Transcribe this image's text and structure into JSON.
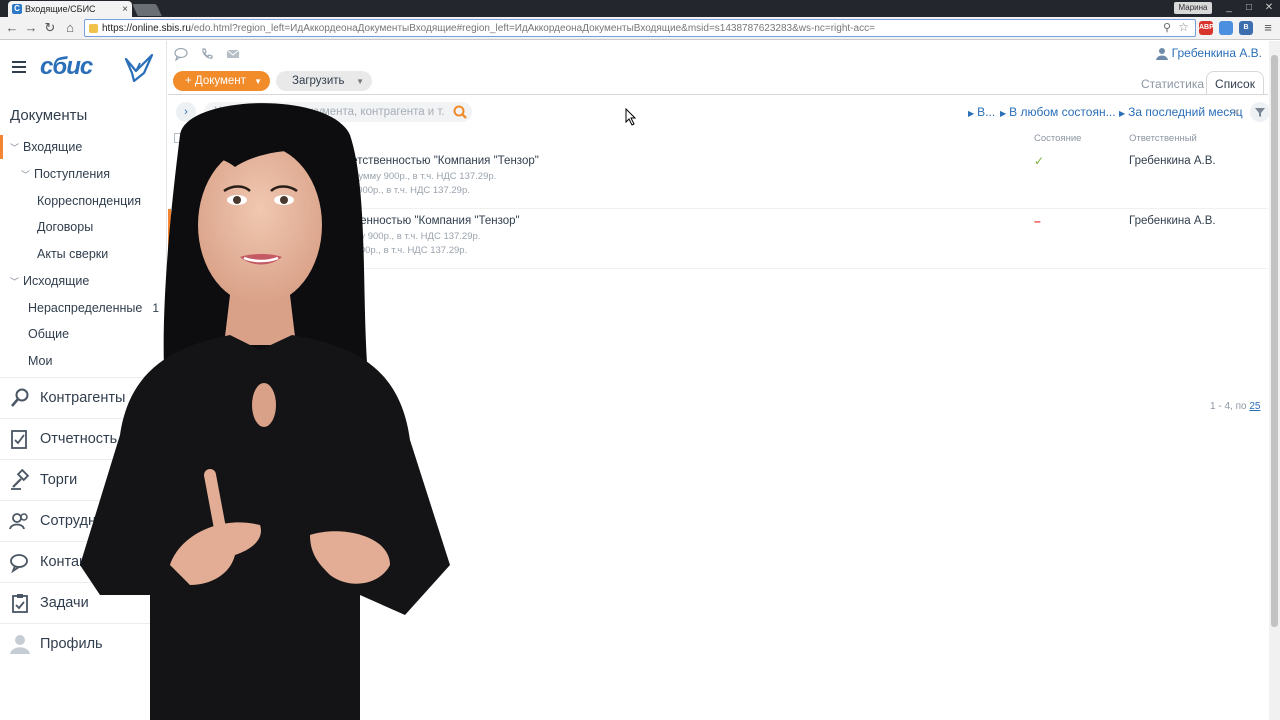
{
  "browser": {
    "tab_title": "Входящие/СБИС",
    "tab_favicon": "С",
    "close_tab": "×",
    "profile_name": "Марина",
    "url_host": "https://online.sbis.ru",
    "url_path": "/edo.html?region_left=ИдАккордеонаДокументыВходящие#region_left=ИдАккордеонаДокументыВходящие&msid=s1438787623283&ws-nc=right-acc=",
    "ext_labels": [
      "ABP",
      "",
      "B"
    ]
  },
  "sidebar": {
    "logo_text": "сбис",
    "section_title": "Документы",
    "tree": [
      {
        "label": "Входящие",
        "chev": "﹀",
        "active": true
      },
      {
        "label": "Поступления",
        "chev": "﹀"
      },
      {
        "label": "Корреспонденция"
      },
      {
        "label": "Договоры"
      },
      {
        "label": "Акты сверки"
      },
      {
        "label": "Исходящие",
        "chev": "﹀"
      },
      {
        "label": "Нераспределенные",
        "count": "1"
      },
      {
        "label": "Общие"
      },
      {
        "label": "Мои"
      }
    ],
    "sections": [
      {
        "label": "Контрагенты",
        "icon": "search-icon"
      },
      {
        "label": "Отчетность",
        "icon": "report-icon"
      },
      {
        "label": "Торги",
        "icon": "auction-icon"
      },
      {
        "label": "Сотрудники",
        "icon": "people-icon"
      },
      {
        "label": "Контакты",
        "icon": "chat-icon"
      },
      {
        "label": "Задачи",
        "icon": "tasks-icon"
      },
      {
        "label": "Профиль",
        "icon": "profile-icon"
      }
    ]
  },
  "header": {
    "user_name": "Гребенкина А.В.",
    "btn_document": "+ Документ",
    "btn_upload": "Загрузить",
    "tab_stats": "Статистика",
    "tab_list": "Список"
  },
  "filters": {
    "search_placeholder": "Укажите номер документа, контрагента и т.д.",
    "chip_type": "В...",
    "chip_state": "В любом состоян...",
    "chip_period": "За последний месяц",
    "chip_close": "×"
  },
  "list": {
    "col_state": "Состояние",
    "col_responsible": "Ответственный",
    "rows": [
      {
        "title": "05.0                                   й ответственностью \"Компания \"Тензор\"",
        "line1": "1                                          5.08.15 на сумму 900р., в т.ч. НДС 137.29р.",
        "line2": "                                          15 на сумму 900р., в т.ч. НДС 137.29р.",
        "state": "✓",
        "state_color": "#7cb342",
        "responsible": "Гребенкина А.В."
      },
      {
        "title": "                                       ответственностью \"Компания \"Тензор\"",
        "line1": "                                           8.15 на сумму 900р., в т.ч. НДС 137.29р.",
        "line2": "                                           5 на сумму 900р., в т.ч. НДС 137.29р.",
        "state": "–",
        "state_color": "#e53935",
        "responsible": "Гребенкина А.В."
      }
    ],
    "pager_text": "1 - 4, по ",
    "pager_link": "25"
  },
  "colors": {
    "accent": "#f38533",
    "brand_blue": "#2a6fb8"
  }
}
